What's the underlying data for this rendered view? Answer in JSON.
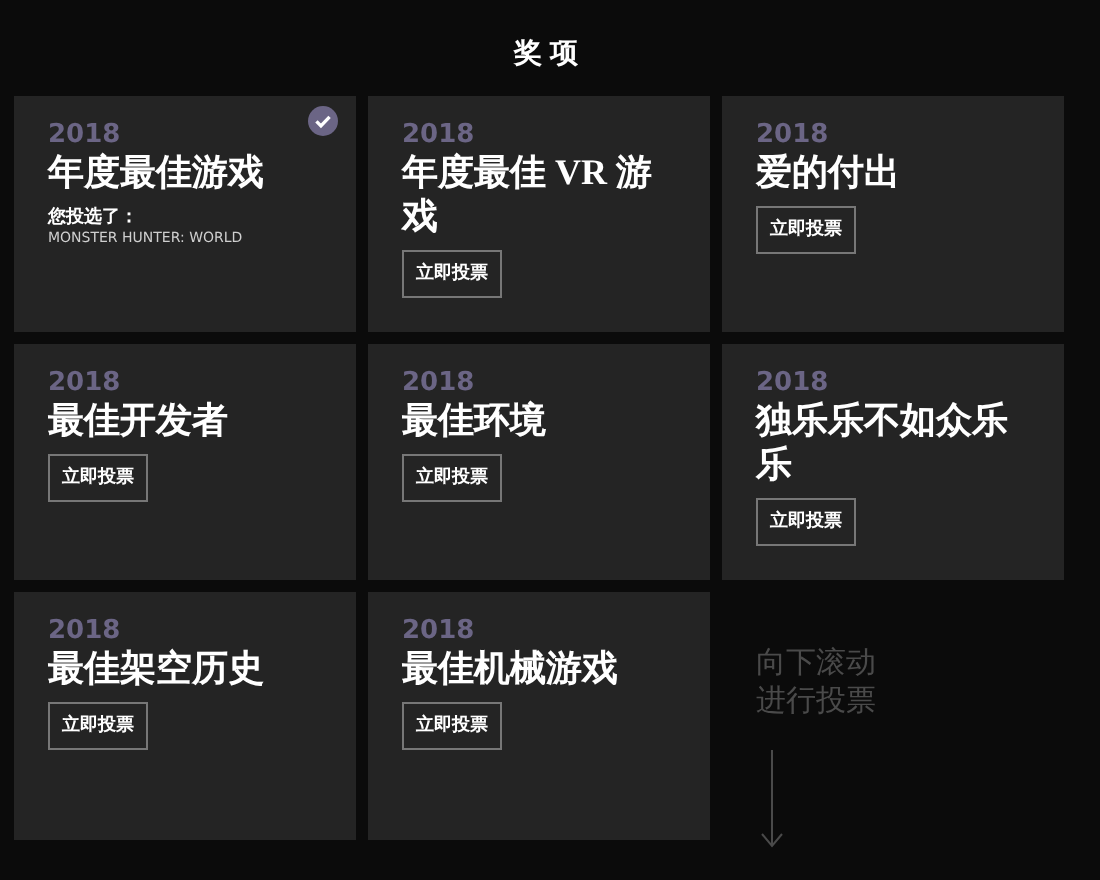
{
  "header": {
    "title": "奖项"
  },
  "awards": [
    {
      "year": "2018",
      "title": "年度最佳游戏",
      "kind": "voted",
      "voted_label": "您投选了：",
      "voted_game": "MONSTER HUNTER: WORLD"
    },
    {
      "year": "2018",
      "title": "年度最佳 **VR** 游戏",
      "kind": "open",
      "button": "立即投票"
    },
    {
      "year": "2018",
      "title": "爱的付出",
      "kind": "open",
      "button": "立即投票"
    },
    {
      "year": "2018",
      "title": "最佳开发者",
      "kind": "open",
      "button": "立即投票"
    },
    {
      "year": "2018",
      "title": "最佳环境",
      "kind": "open",
      "button": "立即投票"
    },
    {
      "year": "2018",
      "title": "独乐乐不如众乐乐",
      "kind": "open",
      "button": "立即投票"
    },
    {
      "year": "2018",
      "title": "最佳架空历史",
      "kind": "open",
      "button": "立即投票"
    },
    {
      "year": "2018",
      "title": "最佳机械游戏",
      "kind": "open",
      "button": "立即投票"
    }
  ],
  "scroll_hint": {
    "text": "向下滚动进行投票"
  }
}
